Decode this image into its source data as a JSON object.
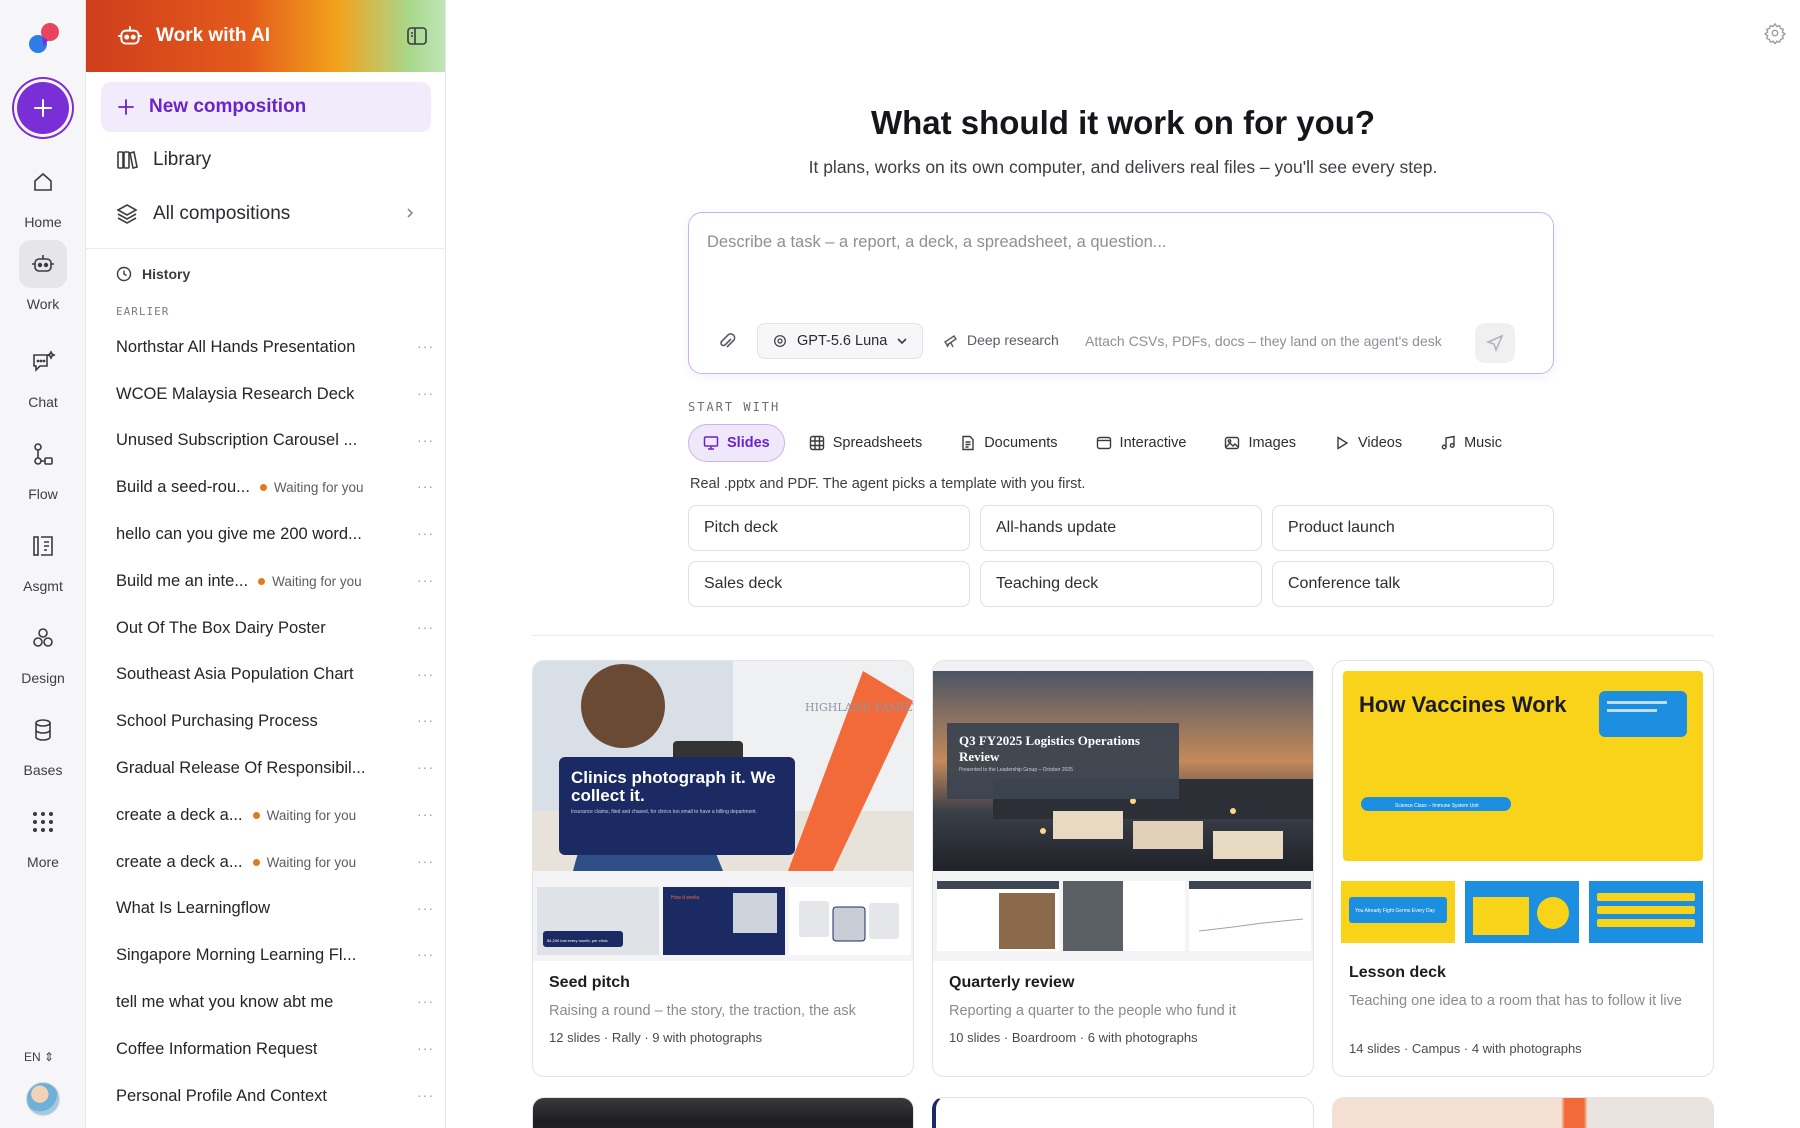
{
  "rail": {
    "items": [
      {
        "label": "Home",
        "icon": "home-icon"
      },
      {
        "label": "Work",
        "icon": "robot-icon",
        "active": true
      },
      {
        "label": "Chat",
        "icon": "chat-sparkle-icon"
      },
      {
        "label": "Flow",
        "icon": "flow-icon"
      },
      {
        "label": "Asgmt",
        "icon": "assignment-icon"
      },
      {
        "label": "Design",
        "icon": "design-icon"
      },
      {
        "label": "Bases",
        "icon": "database-icon"
      },
      {
        "label": "More",
        "icon": "grid-dots-icon"
      }
    ],
    "language": "EN"
  },
  "sidebar": {
    "title": "Work with AI",
    "new_composition": "New composition",
    "library": "Library",
    "all_compositions": "All compositions",
    "history_label": "History",
    "earlier_label": "EARLIER",
    "history": [
      {
        "name": "Northstar All Hands Presentation"
      },
      {
        "name": "WCOE Malaysia Research Deck"
      },
      {
        "name": "Unused Subscription Carousel ..."
      },
      {
        "name": "Build a seed-rou...",
        "status": "Waiting for you"
      },
      {
        "name": "hello can you give me 200 word..."
      },
      {
        "name": "Build me an inte...",
        "status": "Waiting for you"
      },
      {
        "name": "Out Of The Box Dairy Poster"
      },
      {
        "name": "Southeast Asia Population Chart"
      },
      {
        "name": "School Purchasing Process"
      },
      {
        "name": "Gradual Release Of Responsibil..."
      },
      {
        "name": "create a deck a...",
        "status": "Waiting for you"
      },
      {
        "name": "create a deck a...",
        "status": "Waiting for you"
      },
      {
        "name": "What Is Learningflow"
      },
      {
        "name": "Singapore Morning Learning Fl..."
      },
      {
        "name": "tell me what you know abt me"
      },
      {
        "name": "Coffee Information Request"
      },
      {
        "name": "Personal Profile And Context"
      }
    ]
  },
  "main": {
    "title": "What should it work on for you?",
    "subtitle": "It plans, works on its own computer, and delivers real files – you'll see every step.",
    "composer": {
      "placeholder": "Describe a task – a report, a deck, a spreadsheet, a question...",
      "model": "GPT-5.6 Luna",
      "deep_research": "Deep research",
      "hint": "Attach CSVs, PDFs, docs – they land on the agent's desk"
    },
    "start_with": "START WITH",
    "tabs": [
      {
        "label": "Slides",
        "icon": "slides-icon",
        "active": true
      },
      {
        "label": "Spreadsheets",
        "icon": "table-icon"
      },
      {
        "label": "Documents",
        "icon": "document-icon"
      },
      {
        "label": "Interactive",
        "icon": "window-icon"
      },
      {
        "label": "Images",
        "icon": "image-icon"
      },
      {
        "label": "Videos",
        "icon": "play-icon"
      },
      {
        "label": "Music",
        "icon": "music-icon"
      }
    ],
    "tab_description": "Real .pptx and PDF. The agent picks a template with you first.",
    "suggestions": [
      "Pitch deck",
      "All-hands update",
      "Product launch",
      "Sales deck",
      "Teaching deck",
      "Conference talk"
    ],
    "templates": [
      {
        "name": "Seed pitch",
        "description": "Raising a round – the story, the traction, the ask",
        "meta": "12 slides · Rally · 9 with photographs",
        "slide_title": "Clinics photograph it. We collect it.",
        "slide_caption": "Insurance claims, filed and chased, for clinics too small to have a billing department.",
        "sign_text": "HIGHLAND FAMILY",
        "mini_texts": [
          "$4,200 lost every month, per clinic",
          "How it works"
        ]
      },
      {
        "name": "Quarterly review",
        "description": "Reporting a quarter to the people who fund it",
        "meta": "10 slides · Boardroom · 6 with photographs",
        "slide_title": "Q3 FY2025 Logistics Operations Review",
        "slide_caption": "Presented to the Leadership Group – October 2025"
      },
      {
        "name": "Lesson deck",
        "description": "Teaching one idea to a room that has to follow it live",
        "meta": "14 slides · Campus · 4 with photographs",
        "slide_title": "How Vaccines Work",
        "slide_caption": "Science Class – Immune System Unit",
        "mini_texts": [
          "You Already Fight Germs Every Day"
        ]
      }
    ]
  },
  "colors": {
    "accent": "#7a2fd6",
    "accent_light": "#efe8fb",
    "waiting_dot": "#e07a1a",
    "lesson_yellow": "#f9d21a",
    "lesson_blue": "#1d8fe0",
    "pitch_navy": "#1c2a63",
    "pitch_orange": "#f26a3a"
  }
}
